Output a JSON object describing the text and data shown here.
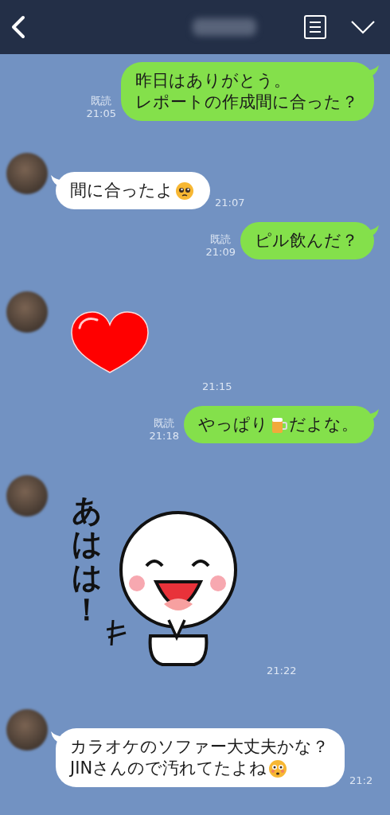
{
  "messages": [
    {
      "mine": true,
      "kind": "text",
      "read": "既読",
      "time": "21:05",
      "lines": [
        [
          {
            "kind": "text",
            "text": "昨日はありがとう。"
          }
        ],
        [
          {
            "kind": "text",
            "text": "レポートの作成間に合った？"
          }
        ]
      ]
    },
    {
      "mine": false,
      "kind": "text",
      "time": "21:07",
      "lines": [
        [
          {
            "kind": "text",
            "text": "間に合ったよ"
          },
          {
            "kind": "pleading"
          }
        ]
      ]
    },
    {
      "mine": true,
      "kind": "text",
      "read": "既読",
      "time": "21:09",
      "lines": [
        [
          {
            "kind": "text",
            "text": "ピル飲んだ？"
          }
        ]
      ]
    },
    {
      "mine": false,
      "kind": "heart_sticker",
      "time": "21:15"
    },
    {
      "mine": true,
      "kind": "text",
      "read": "既読",
      "time": "21:18",
      "lines": [
        [
          {
            "kind": "text",
            "text": "やっぱり"
          },
          {
            "kind": "beer"
          },
          {
            "kind": "text",
            "text": "だよな。"
          }
        ]
      ]
    },
    {
      "mine": false,
      "kind": "character_sticker",
      "sticker_text": "あはは！",
      "time": "21:22"
    },
    {
      "mine": false,
      "kind": "text",
      "time": "21:2",
      "lines": [
        [
          {
            "kind": "text",
            "text": "カラオケのソファー大丈夫かな？"
          }
        ],
        [
          {
            "kind": "text",
            "text": "JINさんので汚れてたよね "
          },
          {
            "kind": "flushed"
          }
        ]
      ]
    }
  ]
}
